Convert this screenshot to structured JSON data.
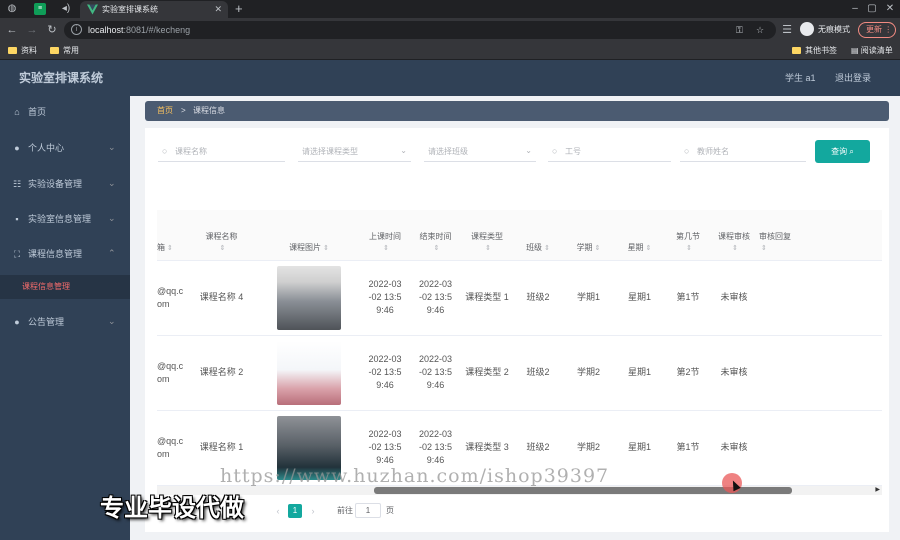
{
  "browser": {
    "tab_title": "实验室排课系统",
    "url_host": "localhost",
    "url_rest": ":8081/#/kecheng",
    "incognito_label": "无痕模式",
    "update_label": "更新",
    "bookmarks": [
      "资料",
      "常用"
    ],
    "bookmarks_right": [
      "其他书签",
      "阅读清单"
    ]
  },
  "header": {
    "title": "实验室排课系统",
    "user": "学生 a1",
    "logout": "退出登录"
  },
  "sidebar": {
    "items": [
      {
        "label": "首页",
        "icon": "home-icon"
      },
      {
        "label": "个人中心",
        "icon": "user-icon"
      },
      {
        "label": "实验设备管理",
        "icon": "sliders-icon"
      },
      {
        "label": "实验室信息管理",
        "icon": "chat-icon"
      },
      {
        "label": "课程信息管理",
        "icon": "fullscreen-icon"
      },
      {
        "label": "公告管理",
        "icon": "user-icon"
      }
    ],
    "active_sub": "课程信息管理"
  },
  "breadcrumb": {
    "home": "首页",
    "sep": ">",
    "current": "课程信息"
  },
  "search": {
    "course_name_placeholder": "课程名称",
    "course_type_placeholder": "请选择课程类型",
    "class_placeholder": "请选择班级",
    "job_no_placeholder": "工号",
    "teacher_placeholder": "教师姓名",
    "query_label": "查询"
  },
  "table": {
    "headers": [
      "箱",
      "课程名称",
      "课程图片",
      "上课时间",
      "结束时间",
      "课程类型",
      "班级",
      "学期",
      "星期",
      "第几节",
      "课程审核",
      "审核回复"
    ],
    "rows": [
      {
        "email": "@qq.c om",
        "name": "课程名称 4",
        "start": "2022-03 -02 13:5 9:46",
        "end": "2022-03 -02 13:5 9:46",
        "type": "课程类型 1",
        "class": "班级2",
        "term": "学期1",
        "week": "星期1",
        "period": "第1节",
        "audit": "未审核",
        "reply": ""
      },
      {
        "email": "@qq.c om",
        "name": "课程名称 2",
        "start": "2022-03 -02 13:5 9:46",
        "end": "2022-03 -02 13:5 9:46",
        "type": "课程类型 2",
        "class": "班级2",
        "term": "学期2",
        "week": "星期1",
        "period": "第2节",
        "audit": "未审核",
        "reply": ""
      },
      {
        "email": "@qq.c om",
        "name": "课程名称 1",
        "start": "2022-03 -02 13:5 9:46",
        "end": "2022-03 -02 13:5 9:46",
        "type": "课程类型 3",
        "class": "班级2",
        "term": "学期2",
        "week": "星期1",
        "period": "第1节",
        "audit": "未审核",
        "reply": ""
      }
    ]
  },
  "pager": {
    "current": "1",
    "goto_label": "前往",
    "goto_value": "1",
    "unit": "页"
  },
  "overlay": {
    "watermark_url": "https://www.huzhan.com/ishop39397",
    "ad_text": "专业毕设代做"
  },
  "colors": {
    "sidebar_bg": "#304156",
    "primary": "#13a89e",
    "active_sub": "#f56c6c",
    "crumb_home": "#f8c15e"
  }
}
